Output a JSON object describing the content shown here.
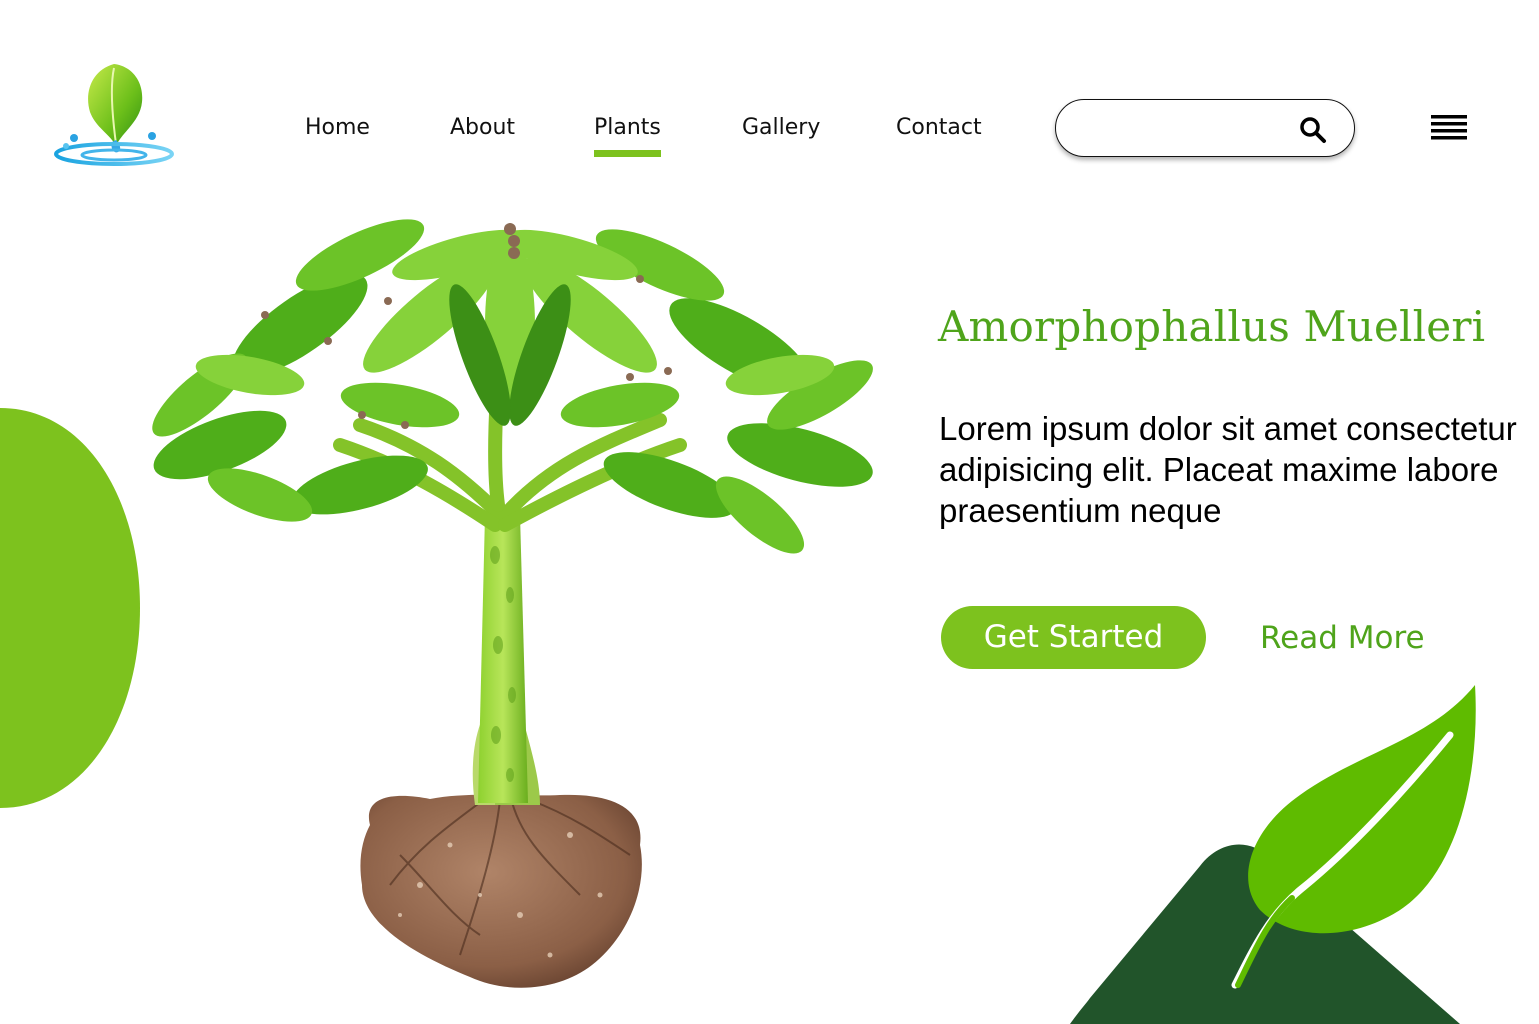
{
  "nav": {
    "items": [
      {
        "label": "Home",
        "active": false
      },
      {
        "label": "About",
        "active": false
      },
      {
        "label": "Plants",
        "active": true
      },
      {
        "label": "Gallery",
        "active": false
      },
      {
        "label": "Contact",
        "active": false
      }
    ]
  },
  "search": {
    "value": "",
    "placeholder": "",
    "icon": "search-icon"
  },
  "menu": {
    "icon": "hamburger-menu-icon"
  },
  "hero": {
    "title": "Amorphophallus Muelleri",
    "description": "Lorem ipsum dolor sit amet consectetur adipisicing elit. Placeat maxime labore praesentium neque",
    "primary_button": "Get Started",
    "secondary_button": "Read More"
  },
  "colors": {
    "accent": "#7dc21e",
    "title": "#4fa41b",
    "dark_green": "#21542a",
    "leaf_green": "#5fbb00"
  }
}
